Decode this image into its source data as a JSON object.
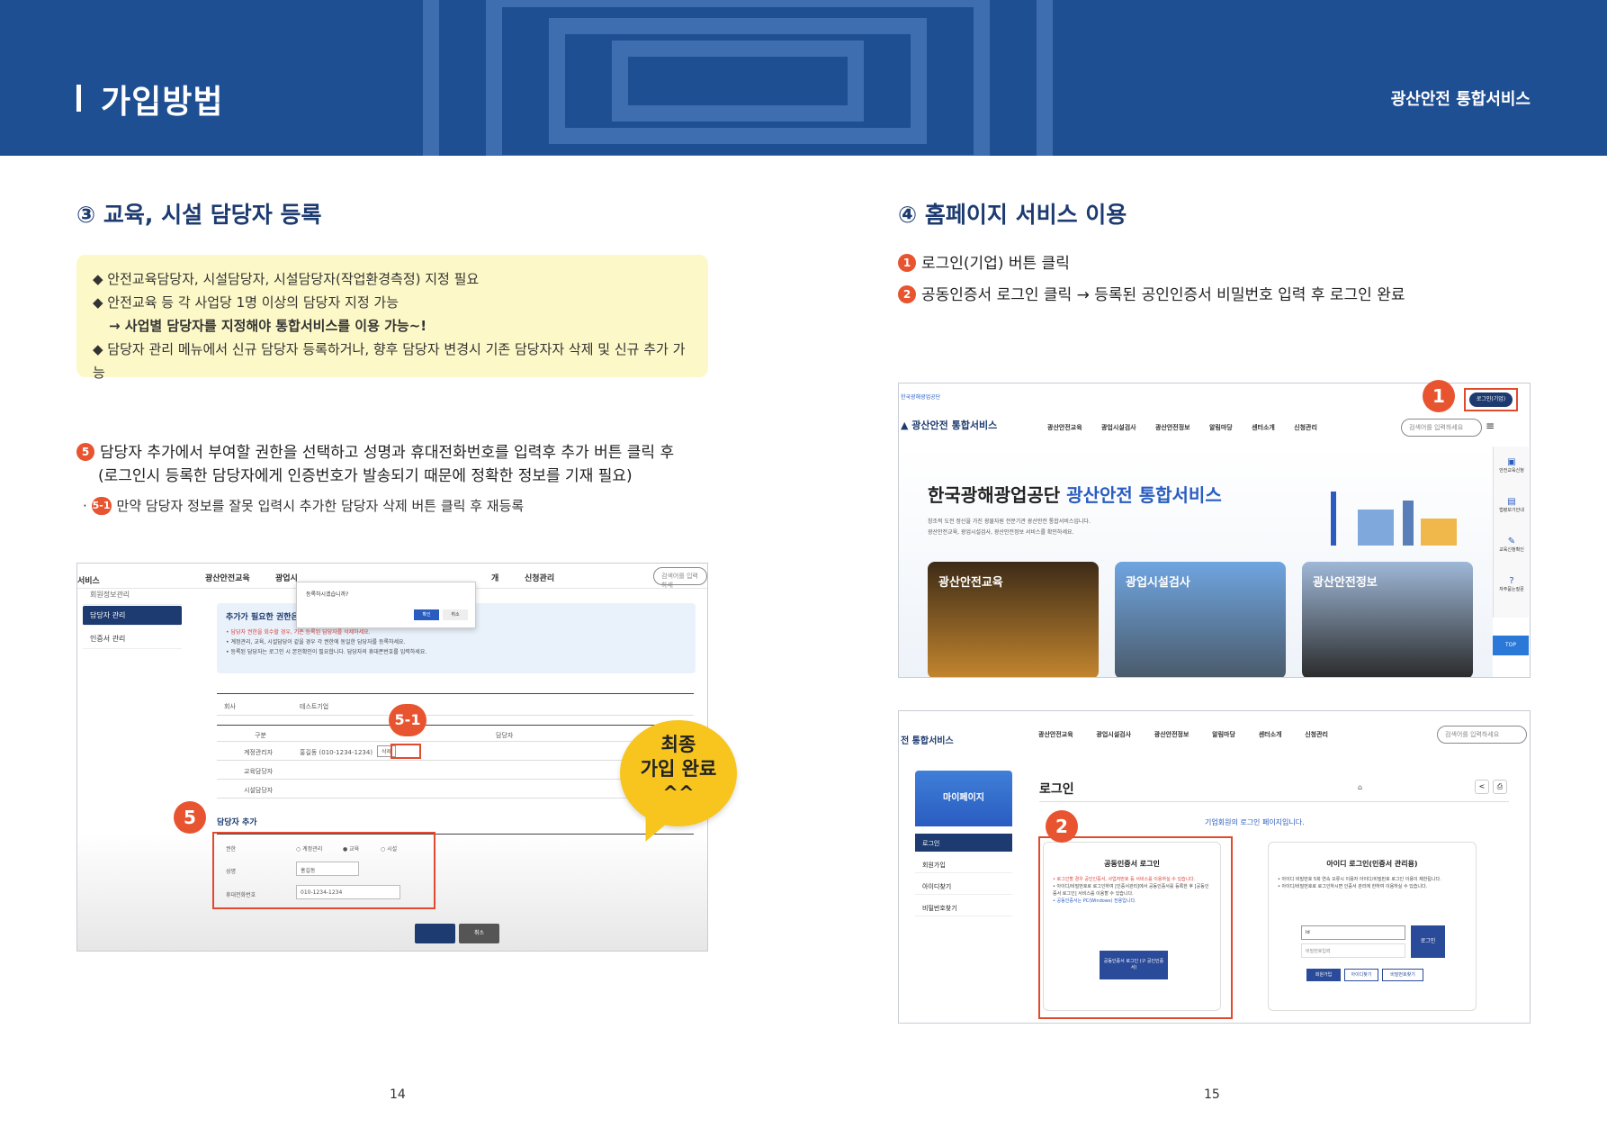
{
  "banner": {
    "title": "가입방법",
    "service": "광산안전 통합서비스"
  },
  "left": {
    "section_title": "③ 교육, 시설 담당자 등록",
    "notes": [
      "◆ 안전교육담당자, 시설담당자, 시설담당자(작업환경측정) 지정 필요",
      "◆ 안전교육 등 각 사업당 1명 이상의 담당자 지정 가능",
      "→ 사업별 담당자를 지정해야 통합서비스를 이용 가능~!",
      "◆ 담당자 관리 메뉴에서 신규 담당자 등록하거나, 향후 담당자 변경시 기존 담당자자 삭제 및 신규 추가 가능"
    ],
    "step5_num": "5",
    "step5_line1": "담당자 추가에서 부여할 권한을 선택하고 성명과 휴대전화번호를 입력후 추가 버튼 클릭 후",
    "step5_line2": "(로그인시 등록한 담당자에게 인증번호가 발송되기 때문에 정확한 정보를 기재 필요)",
    "sub_num": "5-1",
    "sub_text": "만약 담당자 정보를 잘못 입력시 추가한 담당자 삭제 버튼 클릭 후 재등록",
    "bubble": [
      "최종",
      "가입 완료",
      "^^"
    ],
    "page": "14",
    "shot": {
      "nav": [
        "서비스",
        "광산안전교육",
        "광업시",
        "개",
        "신청관리"
      ],
      "search": "검색어를 입력하세",
      "side": [
        "회원정보관리",
        "담당자 관리",
        "인증서 관리"
      ],
      "dialog": {
        "text": "등록하시겠습니까?",
        "ok": "확인",
        "cancel": "취소"
      },
      "box_title": "추가가 필요한 권한은",
      "box_lines": [
        "• 담당자 권한을 회수할 경우, 기존 등록된 담당자를 삭제하세요.",
        "• 계정관리, 교육, 시설담당이 같을 경우 각 권한에 동일한 담당자를 등록하세요.",
        "• 등록된 담당자는 로그인 시 본인확인이 필요합니다. 담당자의 휴대폰번호를 입력하세요."
      ],
      "company_label": "회사",
      "company_value": "테스트기업",
      "col1": "구분",
      "col2": "담당자",
      "rows": [
        "계정관리자",
        "교육담당자",
        "시설담당자"
      ],
      "row1_value": "홍길동 (010-1234-1234)",
      "delete": "삭제",
      "add_title": "담당자 추가",
      "form_labels": [
        "권한",
        "성명",
        "휴대전화번호"
      ],
      "radios": [
        "계정관리",
        "교육",
        "시설"
      ],
      "name_value": "홍길동",
      "phone_value": "010-1234-1234",
      "btn_cancel": "취소",
      "marker_5": "5",
      "marker_51": "5-1"
    }
  },
  "right": {
    "section_title": "④ 홈페이지 서비스 이용",
    "step1_num": "1",
    "step1": "로그인(기업) 버튼 클릭",
    "step2_num": "2",
    "step2": "공동인증서 로그인 클릭 → 등록된 공인인증서 비밀번호 입력 후 로그인 완료",
    "page": "15",
    "shot1": {
      "org": "한국광해광업공단",
      "logo": "광산안전 통합서비스",
      "nav": [
        "광산안전교육",
        "광업시설검사",
        "광산안전정보",
        "알림마당",
        "센터소개",
        "신청관리"
      ],
      "search": "검색어를 입력하세요",
      "login_btn": "로그인(기업)",
      "hero_title_a": "한국광해광업공단",
      "hero_title_b": "광산안전 통합서비스",
      "hero_line1": "창조적 도전 정신을 가진 광물자원 전문기관 광산안전 통합서비스입니다.",
      "hero_line2": "광산안전교육, 광업시설검사, 광산안전정보 서비스를 확인하세요.",
      "cards": [
        "광산안전교육",
        "광업시설검사",
        "광산안전정보"
      ],
      "quick": [
        "안전교육신청",
        "법령보기안내",
        "교육신청확인",
        "자주묻는질문"
      ],
      "top": "TOP",
      "marker": "1"
    },
    "shot2": {
      "logo": "전 통합서비스",
      "nav": [
        "광산안전교육",
        "광업시설검사",
        "광산안전정보",
        "알림마당",
        "센터소개",
        "신청관리"
      ],
      "search": "검색어를 입력하세요",
      "side_title": "마이페이지",
      "side": [
        "로그인",
        "회원가입",
        "아이디찾기",
        "비밀번호찾기"
      ],
      "page_title": "로그인",
      "notice": "기업회원의 로그인 페이지입니다.",
      "box1_title": "공동인증서 로그인",
      "box1_lines": [
        "• 로그인할 경우 공인인증서, 사업자번호 등 서비스를 이용하실 수 있습니다.",
        "• 아이디/비밀번호로 로그인하여 [인증서관리]에서 공동인증서를 등록한 후 [공동인증서 로그인] 서비스를 이용할 수 있습니다.",
        "• 공동인증서는 PC(Windows) 전용입니다."
      ],
      "box1_btn": "공동인증서 로그인 (구 공인인증서)",
      "box2_title": "아이디 로그인(인증서 관리용)",
      "box2_lines": [
        "• 아이디 비밀번호 5회 연속 오류시 이용자 아이디/비밀번호 로그인 이용이 제한됩니다.",
        "• 아이디/비밀번호로 로그인하시면 인증서 관리에 한하여 이용하실 수 있습니다."
      ],
      "id_placeholder": "Id",
      "pw_placeholder": "비밀번호입력",
      "login": "로그인",
      "links": [
        "회원가입",
        "아이디찾기",
        "비밀번호찾기"
      ],
      "marker": "2"
    }
  }
}
